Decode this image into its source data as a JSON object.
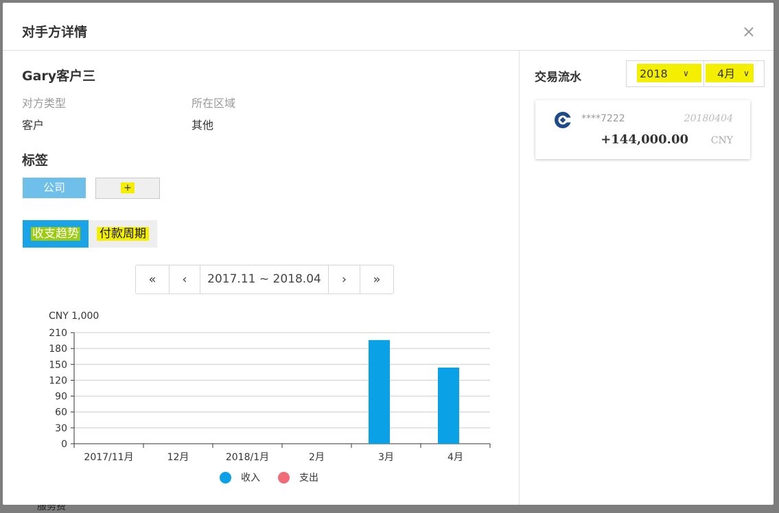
{
  "backdrop": {
    "partial_text": "服务费"
  },
  "modal": {
    "title": "对手方详情",
    "close_symbol": "×"
  },
  "counterparty": {
    "name": "Gary客户三",
    "type_label": "对方类型",
    "type_value": "客户",
    "region_label": "所在区域",
    "region_value": "其他"
  },
  "tags": {
    "section_title": "标签",
    "items": [
      "公司"
    ],
    "add_label": "+"
  },
  "tabs": [
    {
      "label": "收支趋势",
      "active": true
    },
    {
      "label": "付款周期",
      "active": false
    }
  ],
  "pager": {
    "first": "«",
    "prev": "‹",
    "range": "2017.11 ~ 2018.04",
    "next": "›",
    "last": "»"
  },
  "chart_data": {
    "type": "bar",
    "unit_label": "CNY 1,000",
    "categories": [
      "2017/11月",
      "12月",
      "2018/1月",
      "2月",
      "3月",
      "4月"
    ],
    "series": [
      {
        "name": "收入",
        "color": "#0aa1e6",
        "values": [
          0,
          0,
          0,
          0,
          196,
          144
        ]
      },
      {
        "name": "支出",
        "color": "#f06b76",
        "values": [
          0,
          0,
          0,
          0,
          0,
          0
        ]
      }
    ],
    "yticks": [
      0,
      30,
      60,
      90,
      120,
      150,
      180,
      210
    ],
    "ylim": [
      0,
      210
    ],
    "grid": true,
    "legend_position": "bottom"
  },
  "flow": {
    "title": "交易流水",
    "year": "2018",
    "month": "4月",
    "transactions": [
      {
        "account": "****7222",
        "date": "20180404",
        "amount": "+144,000.00",
        "currency": "CNY",
        "bank_icon": "bank-logo-icon"
      }
    ]
  },
  "colors": {
    "accent": "#1ba3e8",
    "tag": "#6ebfea",
    "highlight": "#f4ef00"
  }
}
